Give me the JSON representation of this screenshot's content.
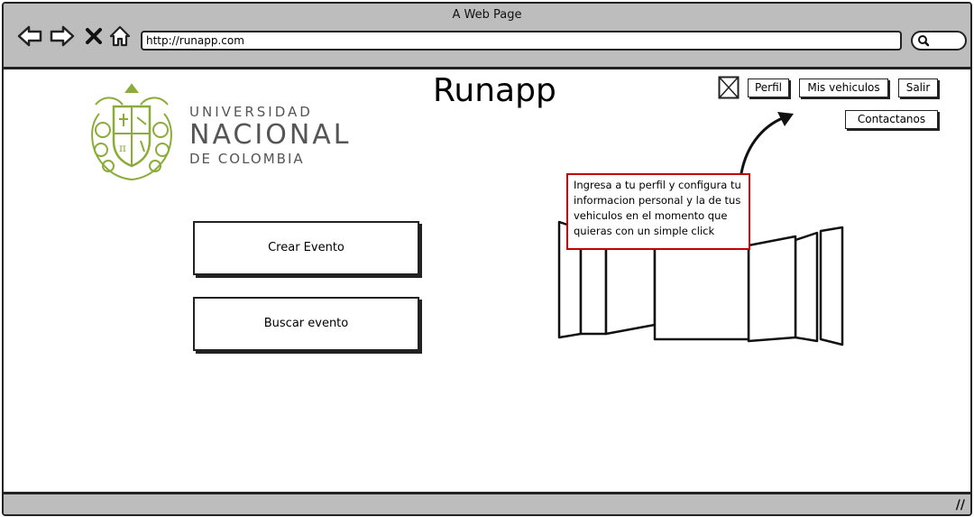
{
  "window": {
    "title": "A Web Page"
  },
  "address_bar": {
    "url": "http://runapp.com"
  },
  "icons": {
    "back": "back-arrow-icon",
    "forward": "forward-arrow-icon",
    "close": "close-x-icon",
    "home": "home-icon",
    "search": "search-icon",
    "resize": "resize-grip-icon",
    "image_placeholder": "image-placeholder-icon"
  },
  "page": {
    "title": "Runapp"
  },
  "logo": {
    "line1": "UNIVERSIDAD",
    "line2": "NACIONAL",
    "line3": "DE COLOMBIA",
    "color": "#8cac3a"
  },
  "nav": {
    "profile": "Perfil",
    "vehicles": "Mis vehiculos",
    "logout": "Salir",
    "contact": "Contactanos"
  },
  "actions": {
    "create_event": "Crear Evento",
    "search_event": "Buscar evento"
  },
  "tooltip": {
    "text": "Ingresa a tu perfil y configura tu informacion personal y la de tus vehiculos en el momento que quieras con un simple click",
    "border_color": "#c00000"
  }
}
